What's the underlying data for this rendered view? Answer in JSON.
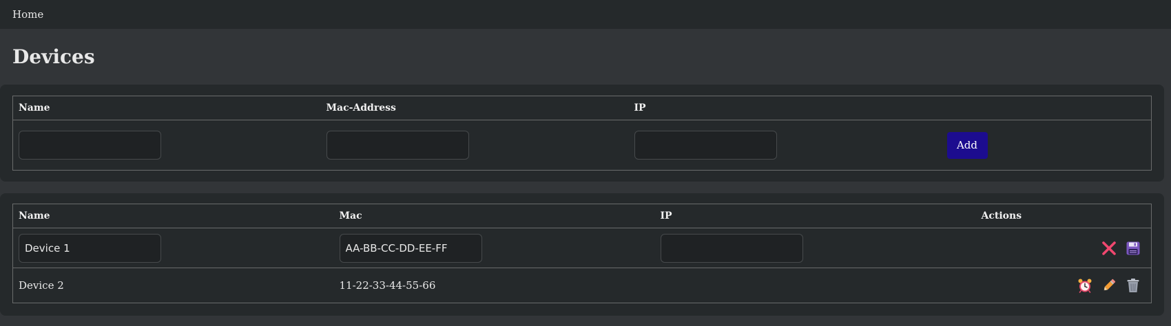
{
  "nav": {
    "home_label": "Home"
  },
  "page": {
    "title": "Devices"
  },
  "add_form": {
    "columns": [
      "Name",
      "Mac-Address",
      "IP"
    ],
    "name_value": "",
    "mac_value": "",
    "ip_value": "",
    "add_label": "Add"
  },
  "devices_table": {
    "columns": [
      "Name",
      "Mac",
      "IP",
      "Actions"
    ],
    "editing_row": {
      "name": "Device 1",
      "mac": "AA-BB-CC-DD-EE-FF",
      "ip": "",
      "actions": [
        "cancel-icon",
        "save-icon"
      ]
    },
    "rows": [
      {
        "name": "Device 2",
        "mac": "11-22-33-44-55-66",
        "ip": "",
        "actions": [
          "alarm-clock-icon",
          "pencil-icon",
          "trash-icon"
        ]
      }
    ]
  },
  "colors": {
    "background": "#323538",
    "card": "#25292b",
    "add_button": "#1c0c8f",
    "cancel_icon": "#f0476f",
    "save_icon": "#8a63c9"
  }
}
